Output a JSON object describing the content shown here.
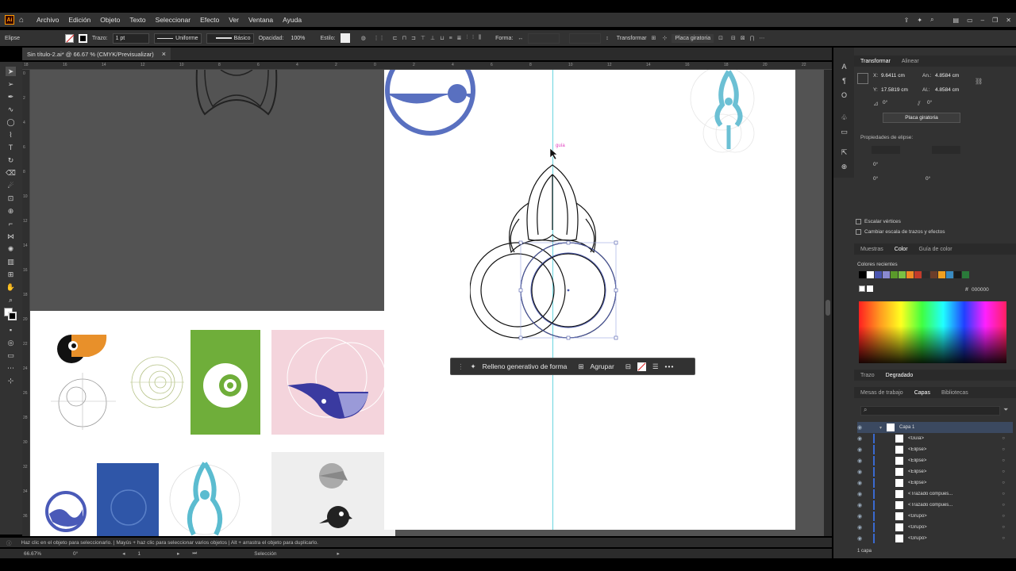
{
  "app": {
    "logo": "Ai",
    "menu": [
      "Archivo",
      "Edición",
      "Objeto",
      "Texto",
      "Seleccionar",
      "Efecto",
      "Ver",
      "Ventana",
      "Ayuda"
    ]
  },
  "control_bar": {
    "selection_type": "Elipse",
    "stroke_label": "Trazo:",
    "stroke_value": "1 pt",
    "profile": "Uniforme",
    "brush": "Básico",
    "opacity_label": "Opacidad:",
    "opacity_value": "100%",
    "style_label": "Estilo:",
    "shape_label": "Forma:",
    "transform_label": "Transformar",
    "pin_label": "Placa giratoria"
  },
  "document": {
    "tab_title": "Sin título-2.ai* @ 66.67 % (CMYK/Previsualizar)",
    "close": "×"
  },
  "ruler": {
    "h_ticks": [
      "18",
      "16",
      "14",
      "12",
      "10",
      "8",
      "6",
      "4",
      "2",
      "0",
      "2",
      "4",
      "6",
      "8",
      "10",
      "12",
      "14",
      "16",
      "18",
      "20",
      "22"
    ],
    "v_ticks": [
      "0",
      "2",
      "4",
      "6",
      "8",
      "10",
      "12",
      "14",
      "16",
      "18",
      "20",
      "22",
      "24",
      "26",
      "28",
      "30",
      "32",
      "34",
      "36"
    ]
  },
  "canvas": {
    "guide_label": "guía"
  },
  "context_bar": {
    "generative_fill": "Relleno generativo de forma",
    "group": "Agrupar",
    "more": "•••"
  },
  "status": {
    "hint": "Haz clic en el objeto para seleccionarlo. | Mayús + haz clic para seleccionar varios objetos | Alt + arrastra el objeto para duplicarlo.",
    "zoom": "66.67%",
    "rotation": "0°",
    "artboard_num": "1",
    "tool": "Selección"
  },
  "transform_panel": {
    "tabs": [
      "Transformar",
      "Alinear"
    ],
    "x_label": "X:",
    "x_value": "9.6411 cm",
    "y_label": "Y:",
    "y_value": "17.5819 cm",
    "w_label": "An.:",
    "w_value": "4.8584 cm",
    "h_label": "Al.:",
    "h_value": "4.8584 cm",
    "angle1": "0°",
    "angle2": "0°",
    "pin_button": "Placa giratoria",
    "ellipse_props": "Propiedades de elipse:",
    "ellipse_a1": "0°",
    "ellipse_a2": "0°",
    "ellipse_a3": "0°",
    "scale_corners": "Escalar vértices",
    "scale_strokes": "Cambiar escala de trazos y efectos"
  },
  "color_panel": {
    "tabs": [
      "Muestras",
      "Color",
      "Guía de color"
    ],
    "recent_label": "Colores recientes",
    "hex_prefix": "#",
    "hex_value": "000000",
    "recent_colors": [
      "#000000",
      "#ffffff",
      "#4a55b0",
      "#8a8ad0",
      "#5a9a2a",
      "#7ac043",
      "#f08a24",
      "#c23b2a",
      "#2b2b2b",
      "#6b3d2a",
      "#f0a020",
      "#3a8ac0",
      "#1a1a1a",
      "#2a7a3a"
    ]
  },
  "stroke_tabs": [
    "Trazo",
    "Degradado"
  ],
  "layers_panel": {
    "tabs": [
      "Mesas de trabajo",
      "Capas",
      "Bibliotecas"
    ],
    "search_placeholder": "",
    "layer_name": "Capa 1",
    "items": [
      "<Guía>",
      "<Elipse>",
      "<Elipse>",
      "<Elipse>",
      "<Elipse>",
      "<Trazado compues...",
      "<Trazado compues...",
      "<Grupo>",
      "<Grupo>",
      "<Grupo>"
    ],
    "footer": "1 capa"
  }
}
